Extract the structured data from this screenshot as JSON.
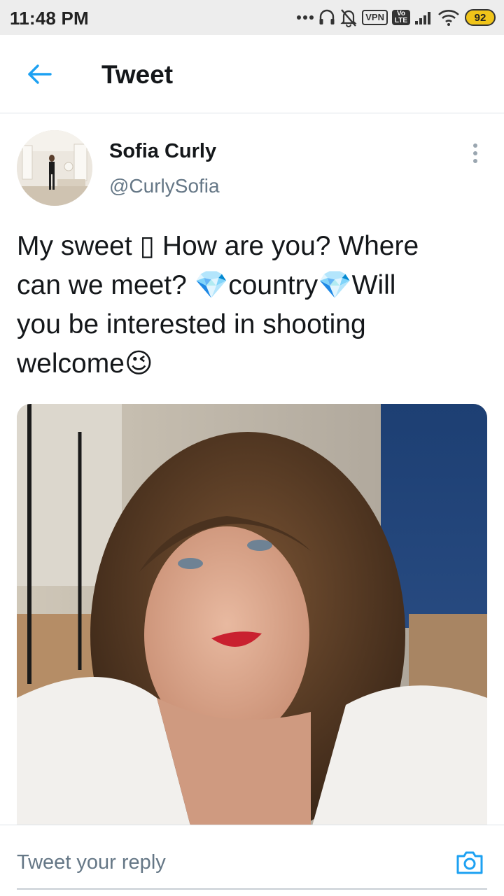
{
  "status_bar": {
    "time": "11:48 PM",
    "vpn_label": "VPN",
    "volte_label": "Vo LTE",
    "battery_level": "92",
    "icons": [
      "more-dots-icon",
      "headphones-icon",
      "bell-off-icon",
      "vpn-icon",
      "volte-icon",
      "signal-icon",
      "wifi-icon",
      "battery-icon"
    ]
  },
  "header": {
    "title": "Tweet",
    "back_icon": "back-arrow-icon"
  },
  "tweet": {
    "author_name": "Sofia Curly",
    "author_handle": "@CurlySofia",
    "text_lines": [
      "My sweet ▯ How are you? Where",
      "can we meet? 💎country💎Will",
      "you be interested in shooting",
      "welcome😉"
    ],
    "more_icon": "more-vertical-icon"
  },
  "reply": {
    "placeholder": "Tweet your reply",
    "camera_icon": "camera-icon"
  },
  "colors": {
    "accent": "#1da1f2",
    "text_primary": "#14171a",
    "text_secondary": "#657786",
    "divider": "#dde3e8",
    "status_bar_bg": "#ededed"
  }
}
